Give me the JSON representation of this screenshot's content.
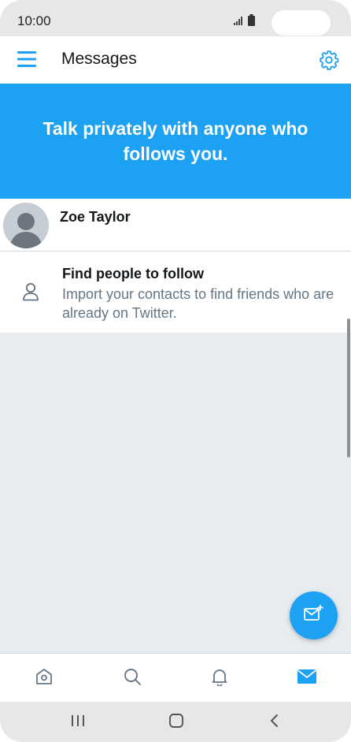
{
  "status_bar": {
    "time": "10:00",
    "icons": [
      "signal-icon",
      "battery-icon"
    ]
  },
  "app_bar": {
    "title": "Messages",
    "left_icon": "menu-icon",
    "right_icon": "gear-icon"
  },
  "banner": {
    "text": "Talk privately with anyone who follows you."
  },
  "conversations": [
    {
      "name": "Zoe Taylor",
      "avatar_icon": "default-avatar-icon"
    }
  ],
  "find_people": {
    "title": "Find people to follow",
    "description": "Import your contacts to find friends who are already on Twitter.",
    "icon": "person-icon"
  },
  "fab": {
    "icon": "new-message-icon"
  },
  "tab_bar": {
    "tabs": [
      {
        "id": "home",
        "icon": "home-icon",
        "active": false
      },
      {
        "id": "search",
        "icon": "search-icon",
        "active": false
      },
      {
        "id": "notifications",
        "icon": "bell-icon",
        "active": false
      },
      {
        "id": "messages",
        "icon": "mail-icon",
        "active": true
      }
    ]
  },
  "system_nav": {
    "buttons": [
      "recent-apps-icon",
      "home-button-icon",
      "back-icon"
    ]
  },
  "colors": {
    "accent": "#1da1f2",
    "text_primary": "#14171a",
    "text_secondary": "#657786",
    "background_empty": "#e6ecf0",
    "system_bar": "#e6e7e9",
    "inactive_icon": "#657786"
  }
}
